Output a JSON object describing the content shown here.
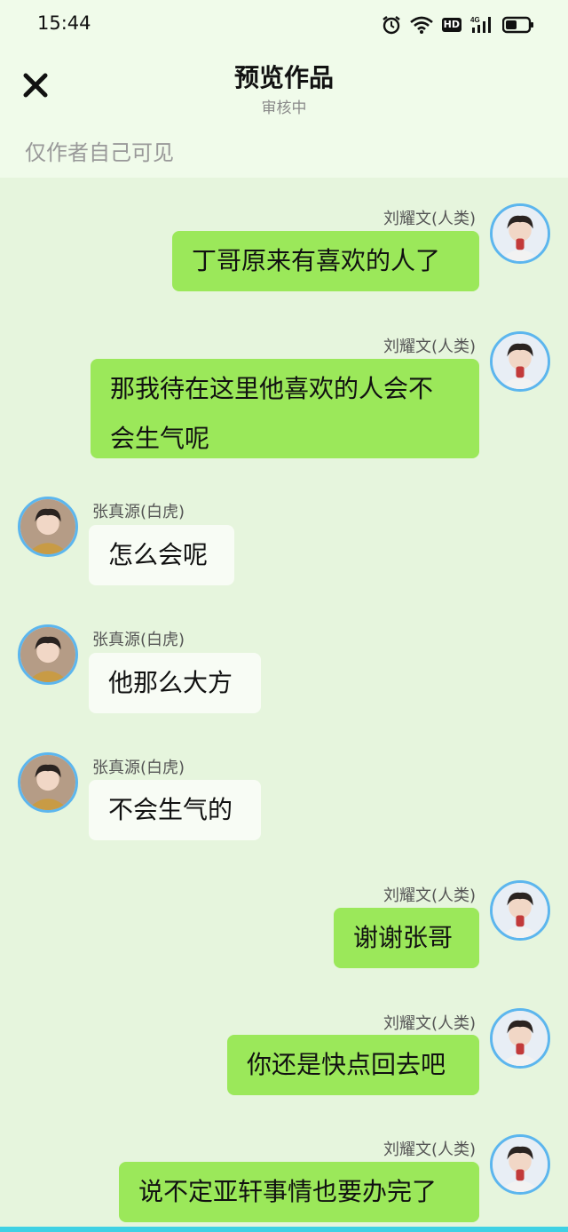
{
  "status_bar": {
    "time": "15:44",
    "icons": [
      "alarm-icon",
      "wifi-icon",
      "hd-badge",
      "signal-4g-icon",
      "battery-icon"
    ],
    "hd_label": "HD"
  },
  "header": {
    "title": "预览作品",
    "subtitle": "审核中",
    "close_icon": "close-icon",
    "visibility_note": "仅作者自己可见"
  },
  "colors": {
    "header_bg": "#f0fbea",
    "chat_bg": "#e6f5dd",
    "right_bubble": "#9be85a",
    "left_bubble": "#f8fcf5",
    "avatar_ring": "#5cb6ee"
  },
  "messages": [
    {
      "side": "right",
      "name": "刘耀文(人类)",
      "lines": [
        "丁哥原来有喜欢的人了"
      ]
    },
    {
      "side": "right",
      "name": "刘耀文(人类)",
      "lines": [
        "那我待在这里他喜欢的人会不",
        "会生气呢"
      ]
    },
    {
      "side": "left",
      "name": "张真源(白虎)",
      "lines": [
        "怎么会呢"
      ]
    },
    {
      "side": "left",
      "name": "张真源(白虎)",
      "lines": [
        "他那么大方"
      ]
    },
    {
      "side": "left",
      "name": "张真源(白虎)",
      "lines": [
        "不会生气的"
      ]
    },
    {
      "side": "right",
      "name": "刘耀文(人类)",
      "lines": [
        "谢谢张哥"
      ]
    },
    {
      "side": "right",
      "name": "刘耀文(人类)",
      "lines": [
        "你还是快点回去吧"
      ]
    },
    {
      "side": "right",
      "name": "刘耀文(人类)",
      "lines": [
        "说不定亚轩事情也要办完了"
      ]
    }
  ]
}
